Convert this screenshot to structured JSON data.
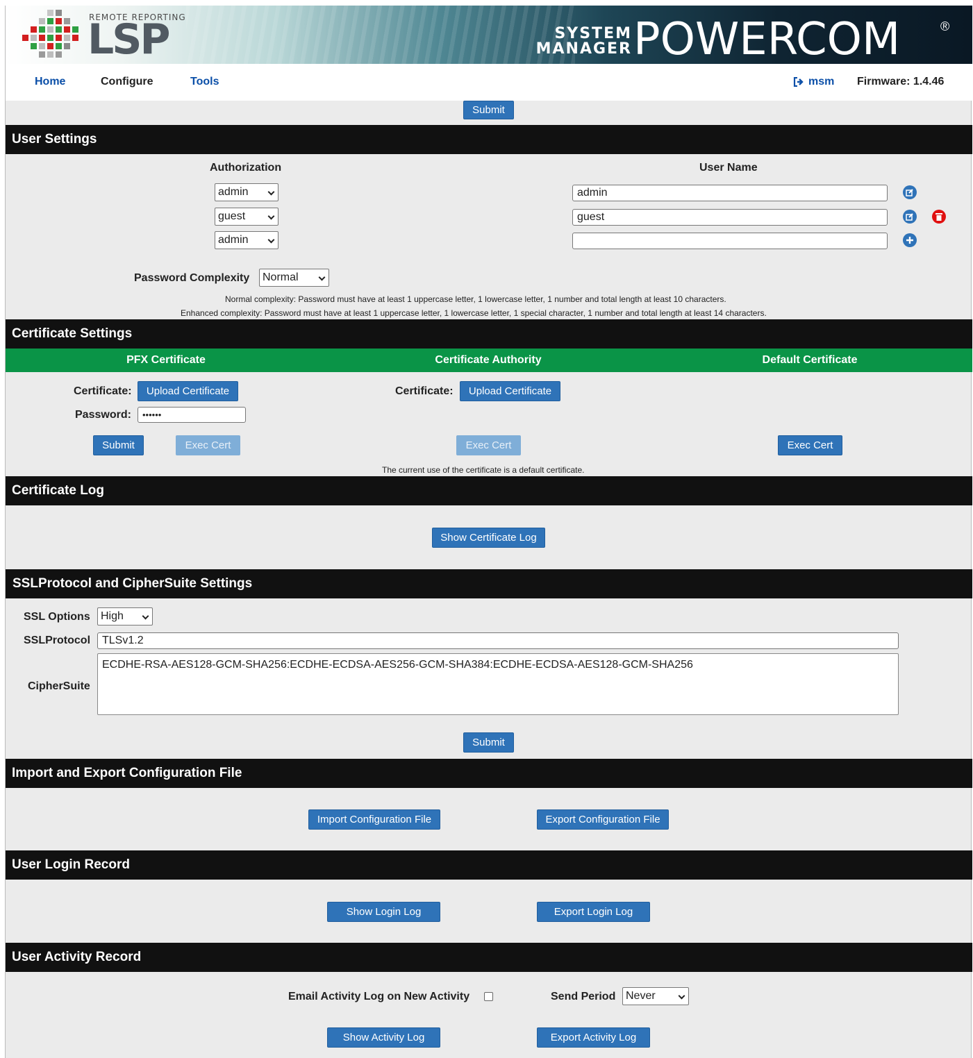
{
  "banner": {
    "brand_sub": "REMOTE REPORTING",
    "brand": "LSP",
    "product_line1": "SYSTEM",
    "product_line2": "MANAGER",
    "product": "POWERCOM",
    "registered": "®"
  },
  "nav": {
    "home": "Home",
    "configure": "Configure",
    "tools": "Tools",
    "user": "msm",
    "firmware": "Firmware: 1.4.46"
  },
  "top_submit": "Submit",
  "user_settings": {
    "title": "User Settings",
    "col_auth": "Authorization",
    "col_username": "User Name",
    "rows": [
      {
        "auth": "admin",
        "username": "admin"
      },
      {
        "auth": "guest",
        "username": "guest"
      },
      {
        "auth": "admin",
        "username": ""
      }
    ],
    "complexity_label": "Password Complexity",
    "complexity_value": "Normal",
    "note_normal": "Normal complexity: Password must have at least 1 uppercase letter, 1 lowercase letter, 1 number and total length at least 10 characters.",
    "note_enhanced": "Enhanced complexity: Password must have at least 1 uppercase letter, 1 lowercase letter, 1 special character, 1 number and total length at least 14 characters."
  },
  "certificate_settings": {
    "title": "Certificate Settings",
    "col_pfx": "PFX Certificate",
    "col_ca": "Certificate Authority",
    "col_default": "Default Certificate",
    "cert_label": "Certificate:",
    "upload": "Upload Certificate",
    "password_label": "Password:",
    "password_value": "••••••",
    "submit": "Submit",
    "exec_cert": "Exec Cert",
    "status": "The current use of the certificate is a default certificate."
  },
  "certificate_log": {
    "title": "Certificate Log",
    "show": "Show Certificate Log"
  },
  "ssl": {
    "title": "SSLProtocol and CipherSuite Settings",
    "options_label": "SSL Options",
    "options_value": "High",
    "protocol_label": "SSLProtocol",
    "protocol_value": "TLSv1.2",
    "cipher_label": "CipherSuite",
    "cipher_value": "ECDHE-RSA-AES128-GCM-SHA256:ECDHE-ECDSA-AES256-GCM-SHA384:ECDHE-ECDSA-AES128-GCM-SHA256",
    "submit": "Submit"
  },
  "import_export": {
    "title": "Import and Export Configuration File",
    "import": "Import Configuration File",
    "export": "Export Configuration File"
  },
  "login_record": {
    "title": "User Login Record",
    "show": "Show Login Log",
    "export": "Export Login Log"
  },
  "activity_record": {
    "title": "User Activity Record",
    "email_label": "Email Activity Log on New Activity",
    "email_checked": false,
    "period_label": "Send Period",
    "period_value": "Never",
    "show": "Show Activity Log",
    "export": "Export Activity Log"
  },
  "colors": {
    "section_bar": "#111111",
    "green_bar": "#0a9447",
    "button": "#2f73b8",
    "button_disabled": "#7faed8",
    "nav_link": "#0b4fa8",
    "delete_icon": "#e01010"
  }
}
